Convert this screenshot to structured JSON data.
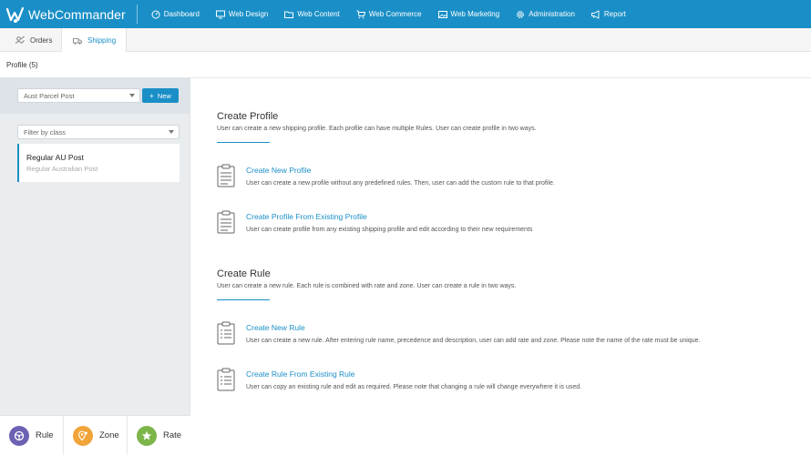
{
  "app": {
    "name": "WebCommander"
  },
  "nav": [
    {
      "label": "Dashboard",
      "icon": "dashboard-icon"
    },
    {
      "label": "Web Design",
      "icon": "monitor-icon"
    },
    {
      "label": "Web Content",
      "icon": "folder-icon"
    },
    {
      "label": "Web Commerce",
      "icon": "cart-icon"
    },
    {
      "label": "Web Marketing",
      "icon": "image-icon"
    },
    {
      "label": "Administration",
      "icon": "gear-icon"
    },
    {
      "label": "Report",
      "icon": "megaphone-icon"
    }
  ],
  "tabs": [
    {
      "label": "Orders",
      "icon": "orders-icon",
      "active": false
    },
    {
      "label": "Shipping",
      "icon": "truck-icon",
      "active": true
    }
  ],
  "profile_bar": {
    "label": "Profile (5)"
  },
  "left": {
    "profile_select": "Aust Parcel Post",
    "new_button": "New",
    "filter_placeholder": "Filter by class",
    "profiles": [
      {
        "name": "Regular AU Post",
        "description": "Regular Australian Post"
      }
    ],
    "bottom_tabs": [
      {
        "label": "Rule",
        "color": "#6b62b3",
        "icon": "steering-icon"
      },
      {
        "label": "Zone",
        "color": "#f0a43a",
        "icon": "location-icon"
      },
      {
        "label": "Rate",
        "color": "#7cb54a",
        "icon": "star-icon"
      }
    ]
  },
  "main": {
    "create_profile": {
      "title": "Create Profile",
      "description": "User can create a new shipping profile. Each profile can have multiple Rules. User can create profile in two ways.",
      "options": [
        {
          "title": "Create New Profile",
          "description": "User can create a new profile without any predefined rules. Then, user can add the custom rule to that profile."
        },
        {
          "title": "Create Profile From Existing Profile",
          "description": "User can create profile from any existing shipping profile and edit according to their new requirements"
        }
      ]
    },
    "create_rule": {
      "title": "Create Rule",
      "description": "User can create a new rule. Each rule is combined with rate and zone. User can create a rule in two ways.",
      "options": [
        {
          "title": "Create New Rule",
          "description": "User can create a new rule. After entering rule name, precedence and description, user can add rate and zone. Please note the name of the rate must be unique."
        },
        {
          "title": "Create Rule From Existing Rule",
          "description": "User can copy an existing rule and edit as required. Please note that changing a rule will change everywhere it is used."
        }
      ]
    }
  },
  "colors": {
    "brand": "#1a8fc7",
    "panel": "#e9edf0"
  }
}
